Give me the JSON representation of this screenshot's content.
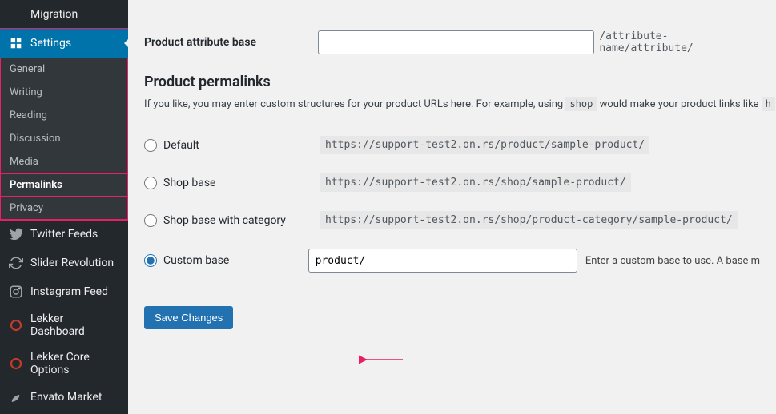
{
  "sidebar": {
    "migration_label": "Migration",
    "settings_label": "Settings",
    "sub": {
      "general": "General",
      "writing": "Writing",
      "reading": "Reading",
      "discussion": "Discussion",
      "media": "Media",
      "permalinks": "Permalinks",
      "privacy": "Privacy"
    },
    "twitter_label": "Twitter Feeds",
    "slider_label": "Slider Revolution",
    "instagram_label": "Instagram Feed",
    "lekker_dash_label": "Lekker Dashboard",
    "lekker_core_label": "Lekker Core Options",
    "envato_label": "Envato Market"
  },
  "form": {
    "attr_base_label": "Product attribute base",
    "attr_base_value": "",
    "attr_base_trail": "/attribute-name/attribute/"
  },
  "permalinks": {
    "heading": "Product permalinks",
    "desc_prefix": "If you like, you may enter custom structures for your product URLs here. For example, using ",
    "desc_tag": "shop",
    "desc_mid": " would make your product links like ",
    "desc_tag2": "h",
    "options": {
      "default_label": "Default",
      "default_url": "https://support-test2.on.rs/product/sample-product/",
      "shop_label": "Shop base",
      "shop_url": "https://support-test2.on.rs/shop/sample-product/",
      "shopcat_label": "Shop base with category",
      "shopcat_url": "https://support-test2.on.rs/shop/product-category/sample-product/",
      "custom_label": "Custom base",
      "custom_value": "product/",
      "custom_hint": "Enter a custom base to use. A base m"
    }
  },
  "save_label": "Save Changes"
}
